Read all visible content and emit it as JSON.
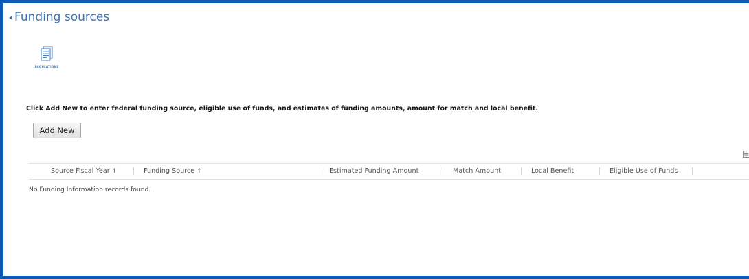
{
  "section": {
    "title": "Funding sources"
  },
  "toolbar": {
    "regulations_label": "REGULATIONS"
  },
  "instructions": "Click Add New to enter federal funding source, eligible use of funds, and estimates of funding amounts, amount for match and local benefit.",
  "add_new_button": "Add New",
  "grid": {
    "columns": [
      {
        "label": "Source Fiscal Year",
        "sort": "↑"
      },
      {
        "label": "Funding Source",
        "sort": "↑"
      },
      {
        "label": "Estimated Funding Amount"
      },
      {
        "label": "Match Amount"
      },
      {
        "label": "Local Benefit"
      },
      {
        "label": "Eligible Use of Funds"
      }
    ],
    "empty_message": "No Funding Information records found."
  },
  "colors": {
    "frame": "#0f5ab4",
    "accent": "#3b73b9",
    "background": "#ffffff"
  },
  "icons": [
    "collapse-arrow-icon",
    "regulations-document-icon",
    "grid-options-icon"
  ]
}
